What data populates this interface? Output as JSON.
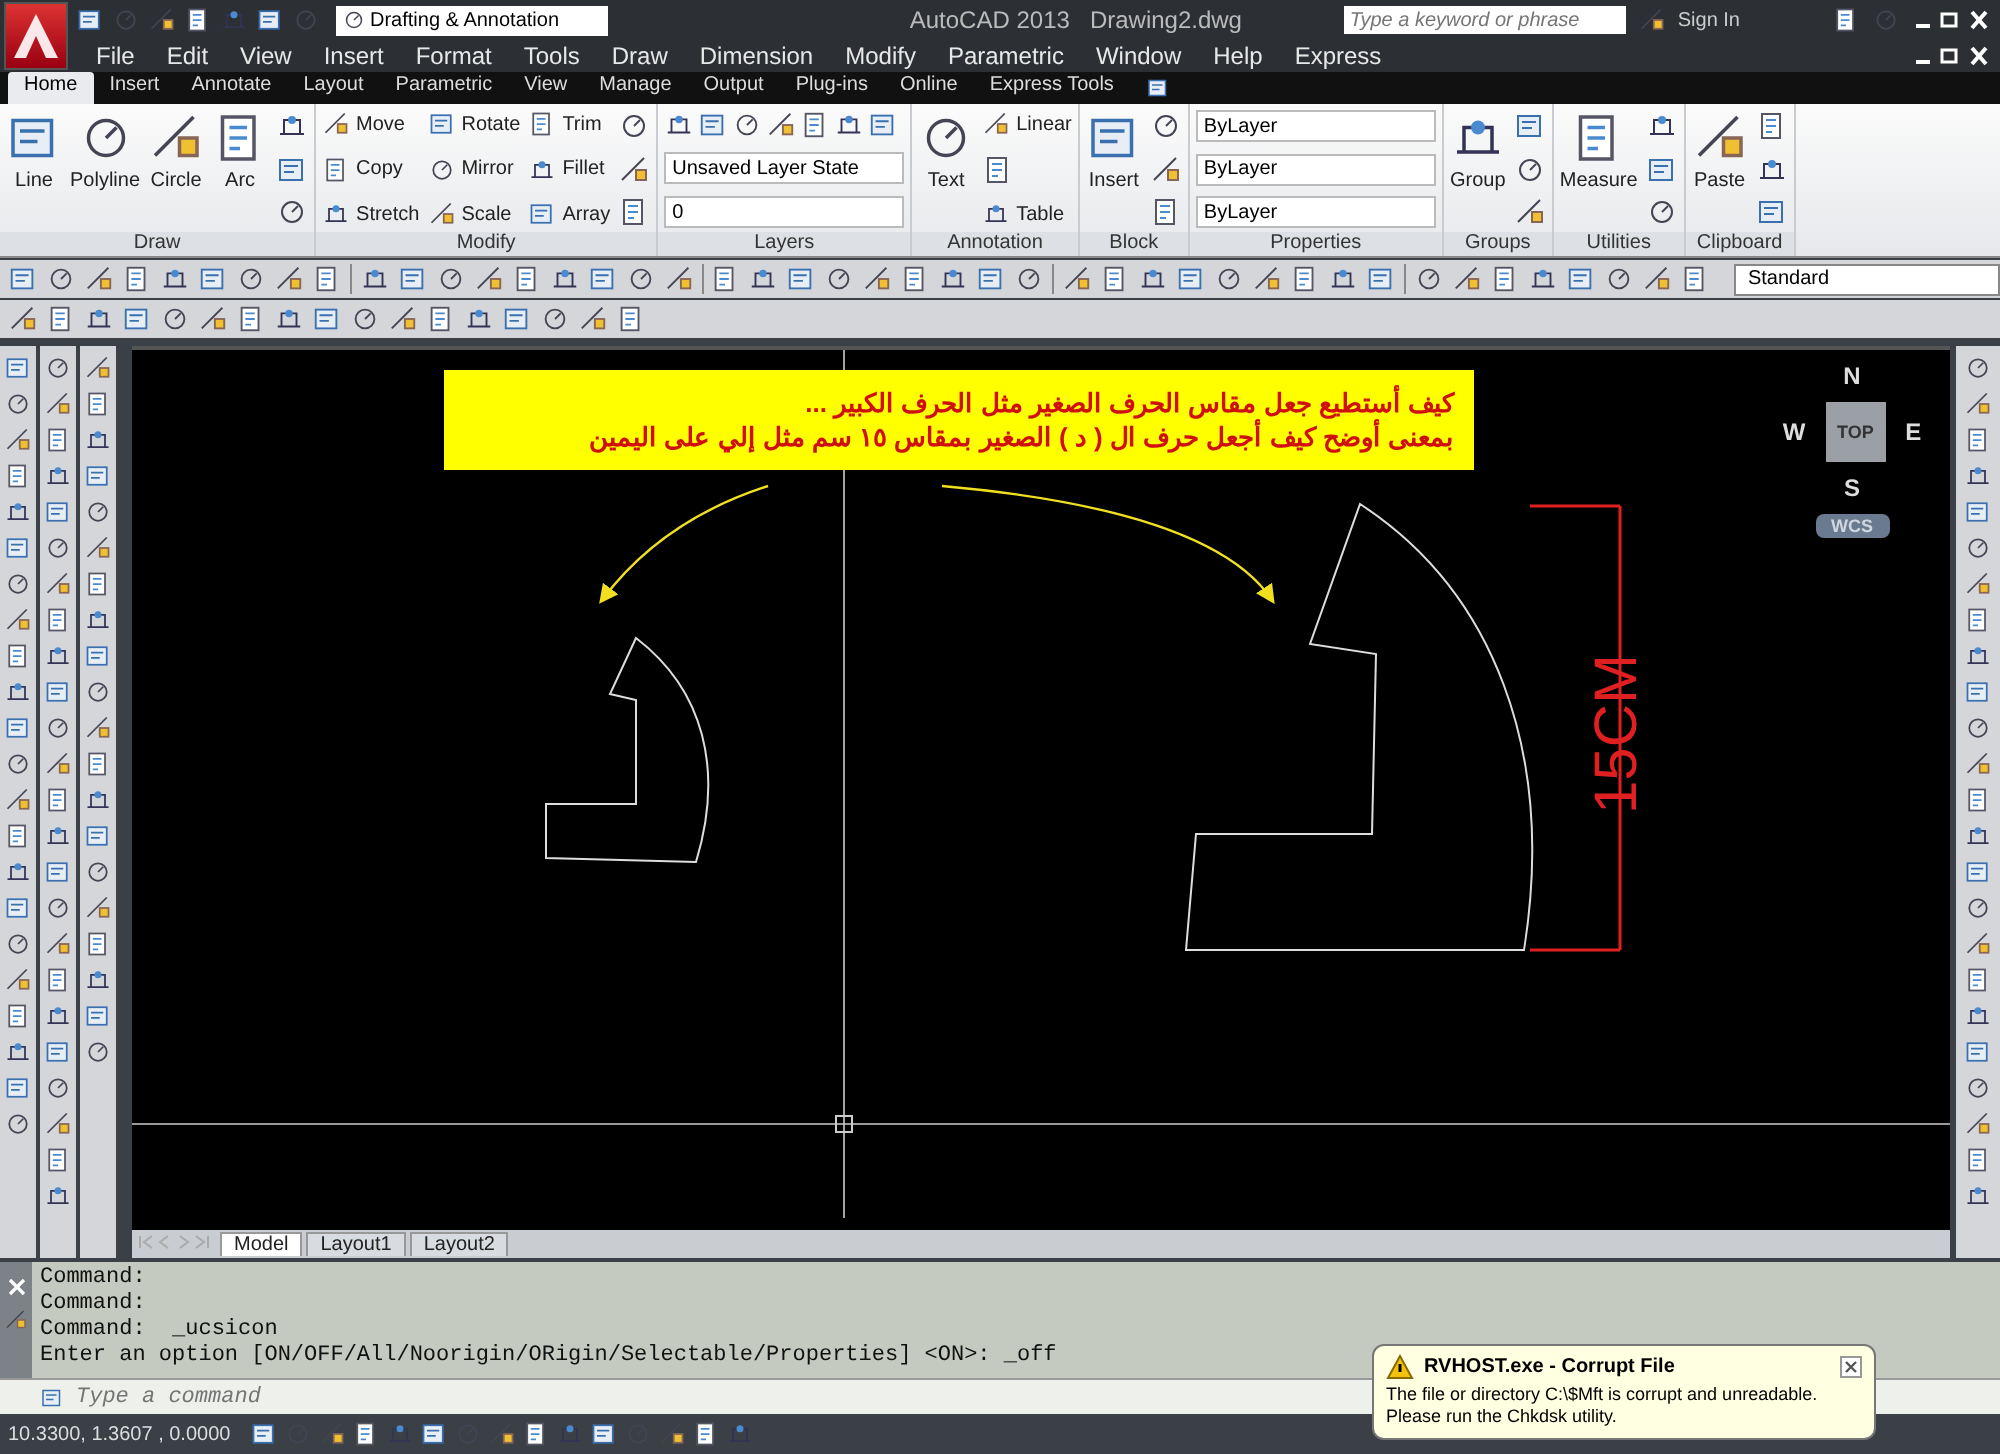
{
  "title_bar": {
    "workspace": "Drafting & Annotation",
    "app": "AutoCAD 2013",
    "document": "Drawing2.dwg",
    "search": {
      "placeholder": "Type a keyword or phrase"
    },
    "sign_in": "Sign In"
  },
  "menu": [
    "File",
    "Edit",
    "View",
    "Insert",
    "Format",
    "Tools",
    "Draw",
    "Dimension",
    "Modify",
    "Parametric",
    "Window",
    "Help",
    "Express"
  ],
  "ribbon_tabs": [
    {
      "label": "Home",
      "selected": true
    },
    {
      "label": "Insert",
      "selected": false
    },
    {
      "label": "Annotate",
      "selected": false
    },
    {
      "label": "Layout",
      "selected": false
    },
    {
      "label": "Parametric",
      "selected": false
    },
    {
      "label": "View",
      "selected": false
    },
    {
      "label": "Manage",
      "selected": false
    },
    {
      "label": "Output",
      "selected": false
    },
    {
      "label": "Plug-ins",
      "selected": false
    },
    {
      "label": "Online",
      "selected": false
    },
    {
      "label": "Express Tools",
      "selected": false
    }
  ],
  "ribbon_panels": [
    {
      "title": "Draw",
      "columns": [
        [
          {
            "kind": "large",
            "label": "Line"
          }
        ],
        [
          {
            "kind": "large",
            "label": "Polyline"
          }
        ],
        [
          {
            "kind": "large",
            "label": "Circle"
          }
        ],
        [
          {
            "kind": "large",
            "label": "Arc"
          }
        ],
        [
          {
            "kind": "icon"
          },
          {
            "kind": "icon"
          },
          {
            "kind": "icon"
          }
        ]
      ]
    },
    {
      "title": "Modify",
      "columns": [
        [
          {
            "kind": "small",
            "label": "Move"
          },
          {
            "kind": "small",
            "label": "Copy"
          },
          {
            "kind": "small",
            "label": "Stretch"
          }
        ],
        [
          {
            "kind": "small",
            "label": "Rotate"
          },
          {
            "kind": "small",
            "label": "Mirror"
          },
          {
            "kind": "small",
            "label": "Scale"
          }
        ],
        [
          {
            "kind": "small",
            "label": "Trim"
          },
          {
            "kind": "small",
            "label": "Fillet"
          },
          {
            "kind": "small",
            "label": "Array"
          }
        ],
        [
          {
            "kind": "icon"
          },
          {
            "kind": "icon"
          },
          {
            "kind": "icon"
          }
        ]
      ]
    },
    {
      "title": "Layers",
      "columns": [
        [
          {
            "kind": "iconrow"
          },
          {
            "kind": "dropdown",
            "label": "Unsaved Layer State"
          },
          {
            "kind": "dropdown",
            "label": "0"
          }
        ]
      ]
    },
    {
      "title": "Annotation",
      "columns": [
        [
          {
            "kind": "large",
            "label": "Text"
          }
        ],
        [
          {
            "kind": "small",
            "label": "Linear"
          },
          {
            "kind": "icon"
          },
          {
            "kind": "small",
            "label": "Table"
          }
        ]
      ]
    },
    {
      "title": "Block",
      "columns": [
        [
          {
            "kind": "large",
            "label": "Insert"
          }
        ],
        [
          {
            "kind": "icon"
          },
          {
            "kind": "icon"
          },
          {
            "kind": "icon"
          }
        ]
      ]
    },
    {
      "title": "Properties",
      "columns": [
        [
          {
            "kind": "dropdown",
            "label": "ByLayer"
          },
          {
            "kind": "dropdown",
            "label": "ByLayer"
          },
          {
            "kind": "dropdown",
            "label": "ByLayer"
          }
        ]
      ]
    },
    {
      "title": "Groups",
      "columns": [
        [
          {
            "kind": "large",
            "label": "Group"
          }
        ],
        [
          {
            "kind": "icon"
          },
          {
            "kind": "icon"
          },
          {
            "kind": "icon"
          }
        ]
      ]
    },
    {
      "title": "Utilities",
      "columns": [
        [
          {
            "kind": "large",
            "label": "Measure"
          }
        ],
        [
          {
            "kind": "icon"
          },
          {
            "kind": "icon"
          },
          {
            "kind": "icon"
          }
        ]
      ]
    },
    {
      "title": "Clipboard",
      "columns": [
        [
          {
            "kind": "large",
            "label": "Paste"
          }
        ],
        [
          {
            "kind": "icon"
          },
          {
            "kind": "icon"
          },
          {
            "kind": "icon"
          }
        ]
      ]
    }
  ],
  "toolbar_style": "Standard",
  "callout": [
    "كيف أستطيع جعل مقاس الحرف الصغير مثل الحرف الكبير ...",
    "بمعنى أوضح كيف أجعل حرف ال ( د ) الصغير بمقاس ١٥ سم مثل إلي على اليمين"
  ],
  "dimension_text": "15CM",
  "view_cube": {
    "north": "N",
    "west": "W",
    "east": "E",
    "south": "S",
    "face": "TOP",
    "ucs": "WCS"
  },
  "layout_tabs": [
    {
      "label": "Model",
      "selected": true
    },
    {
      "label": "Layout1",
      "selected": false
    },
    {
      "label": "Layout2",
      "selected": false
    }
  ],
  "command_history": [
    "Command:",
    "Command:",
    "Command:  _ucsicon",
    "Enter an option [ON/OFF/All/Noorigin/ORigin/Selectable/Properties] <ON>: _off"
  ],
  "command_line": {
    "placeholder": "Type a command"
  },
  "coordinates": "10.3300, 1.3607 , 0.0000",
  "notification": {
    "title": "RVHOST.exe - Corrupt File",
    "message": "The file or directory C:\\$Mft is corrupt and unreadable. Please run the Chkdsk utility."
  }
}
